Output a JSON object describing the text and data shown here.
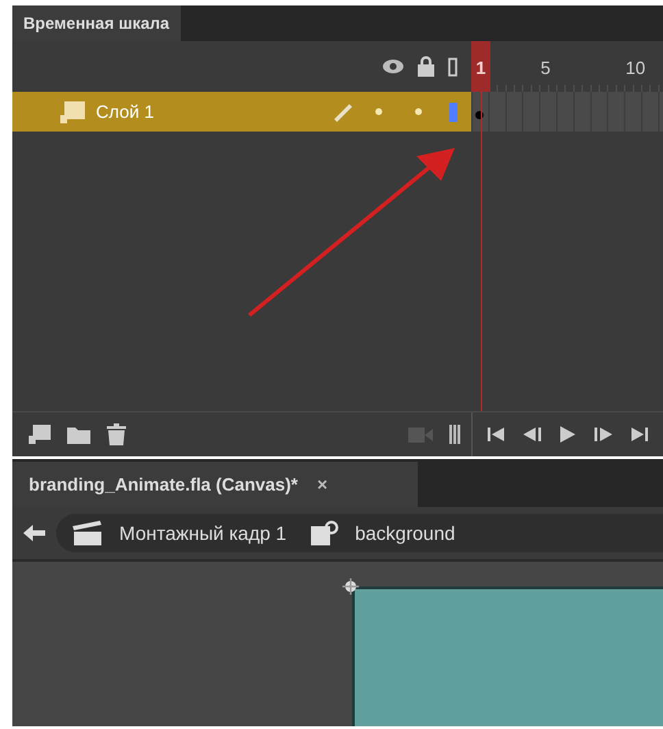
{
  "timeline_tab": {
    "title": "Временная шкала",
    "selected": true
  },
  "ruler": [
    {
      "label": "1",
      "current": true
    },
    {
      "label": "5",
      "current": false
    },
    {
      "label": "10",
      "current": false
    }
  ],
  "layers": [
    {
      "name": "Слой 1",
      "selected": true,
      "color": "#4f7dff"
    }
  ],
  "document_tab": {
    "title": "branding_Animate.fla (Canvas)*",
    "close": "×"
  },
  "breadcrumb": [
    {
      "kind": "scene",
      "label": "Монтажный кадр 1"
    },
    {
      "kind": "symbol",
      "label": "background"
    }
  ]
}
